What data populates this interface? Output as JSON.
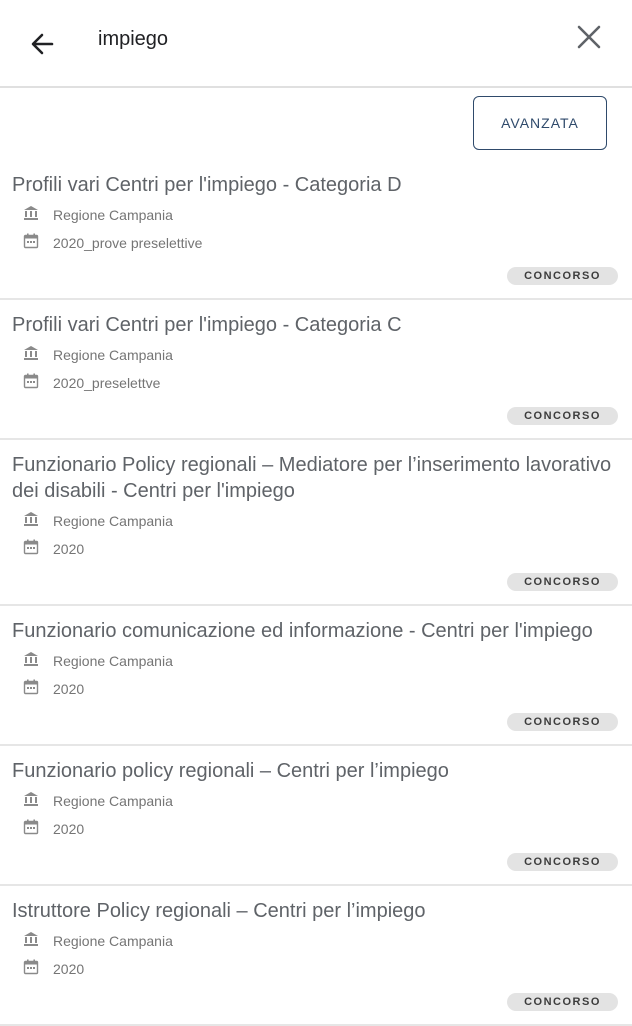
{
  "search": {
    "query": "impiego"
  },
  "advanced_label": "AVANZATA",
  "results": [
    {
      "title": "Profili vari Centri per l'impiego - Categoria D",
      "organization": "Regione Campania",
      "date": "2020_prove preselettive",
      "badge": "CONCORSO"
    },
    {
      "title": "Profili vari Centri per l'impiego - Categoria C",
      "organization": "Regione Campania",
      "date": "2020_preselettve",
      "badge": "CONCORSO"
    },
    {
      "title": " Funzionario Policy regionali – Mediatore per l’inserimento lavorativo dei disabili - Centri per l'impiego",
      "organization": "Regione Campania",
      "date": "2020",
      "badge": "CONCORSO"
    },
    {
      "title": "Funzionario comunicazione ed informazione - Centri per l'impiego",
      "organization": "Regione Campania",
      "date": "2020",
      "badge": "CONCORSO"
    },
    {
      "title": "Funzionario policy regionali – Centri per l’impiego",
      "organization": "Regione Campania",
      "date": "2020",
      "badge": "CONCORSO"
    },
    {
      "title": "Istruttore Policy regionali – Centri per l’impiego",
      "organization": "Regione Campania",
      "date": "2020",
      "badge": "CONCORSO"
    }
  ],
  "icons": {
    "back": "arrow-left-icon",
    "close": "close-icon",
    "organization": "institution-icon",
    "date": "calendar-icon"
  }
}
